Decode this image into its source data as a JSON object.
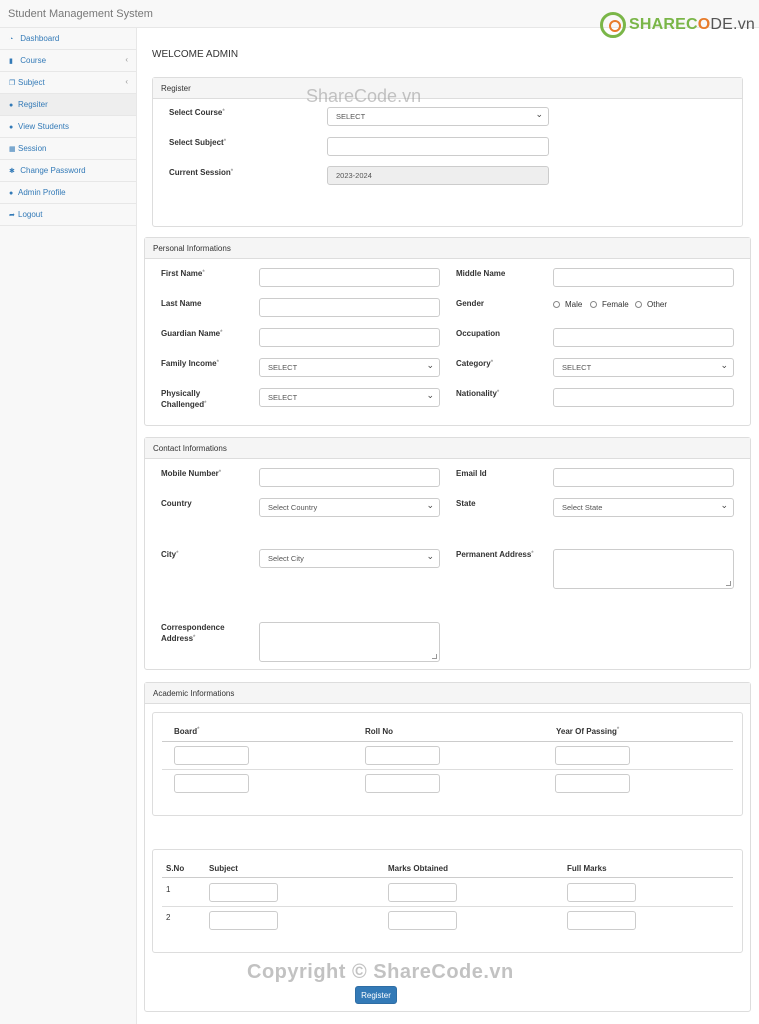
{
  "app": {
    "title": "Student Management System"
  },
  "logo": {
    "a": "SHAREC",
    "o": "O",
    "rest": "DE.vn"
  },
  "sidebar": {
    "items": [
      {
        "label": "Dashboard",
        "icon": "dashboard-icon",
        "glyph": "◔"
      },
      {
        "label": "Course",
        "icon": "file-icon",
        "glyph": "▮",
        "chevron": "‹"
      },
      {
        "label": "Subject",
        "icon": "copy-icon",
        "glyph": "❐",
        "chevron": "‹"
      },
      {
        "label": "Regsiter",
        "icon": "user-icon",
        "glyph": "●"
      },
      {
        "label": "View Students",
        "icon": "users-icon",
        "glyph": "●"
      },
      {
        "label": "Session",
        "icon": "calendar-icon",
        "glyph": "▦"
      },
      {
        "label": "Change Password",
        "icon": "gear-icon",
        "glyph": "✱"
      },
      {
        "label": "Admin Profile",
        "icon": "user-icon",
        "glyph": "●"
      },
      {
        "label": "Logout",
        "icon": "logout-icon",
        "glyph": "➦"
      }
    ]
  },
  "main": {
    "welcome": "WELCOME ADMIN"
  },
  "register": {
    "heading": "Register",
    "course_label": "Select Course",
    "course_value": "SELECT",
    "subject_label": "Select Subject",
    "session_label": "Current Session",
    "session_value": "2023-2024"
  },
  "personal": {
    "heading": "Personal Informations",
    "first_name": "First Name",
    "middle_name": "Middle Name",
    "last_name": "Last Name",
    "gender": "Gender",
    "gender_options": [
      "Male",
      "Female",
      "Other"
    ],
    "guardian": "Guardian Name",
    "occupation": "Occupation",
    "income": "Family Income",
    "income_value": "SELECT",
    "category": "Category",
    "category_value": "SELECT",
    "physically": "Physically",
    "challenged": "Challenged",
    "physically_value": "SELECT",
    "nationality": "Nationality"
  },
  "contact": {
    "heading": "Contact Informations",
    "mobile": "Mobile Number",
    "email": "Email Id",
    "country": "Country",
    "country_value": "Select Country",
    "state": "State",
    "state_value": "Select State",
    "city": "City",
    "city_value": "Select City",
    "perm_address": "Permanent Address",
    "corr1": "Correspondence",
    "corr2": "Address"
  },
  "academic": {
    "heading": "Academic Informations",
    "board": "Board",
    "roll": "Roll No",
    "year": "Year Of Passing",
    "sno": "S.No",
    "subject": "Subject",
    "marks": "Marks Obtained",
    "full": "Full Marks",
    "rows": [
      "1",
      "2"
    ],
    "submit": "Register"
  },
  "watermark": {
    "top": "ShareCode.vn",
    "bottom": "Copyright © ShareCode.vn"
  }
}
